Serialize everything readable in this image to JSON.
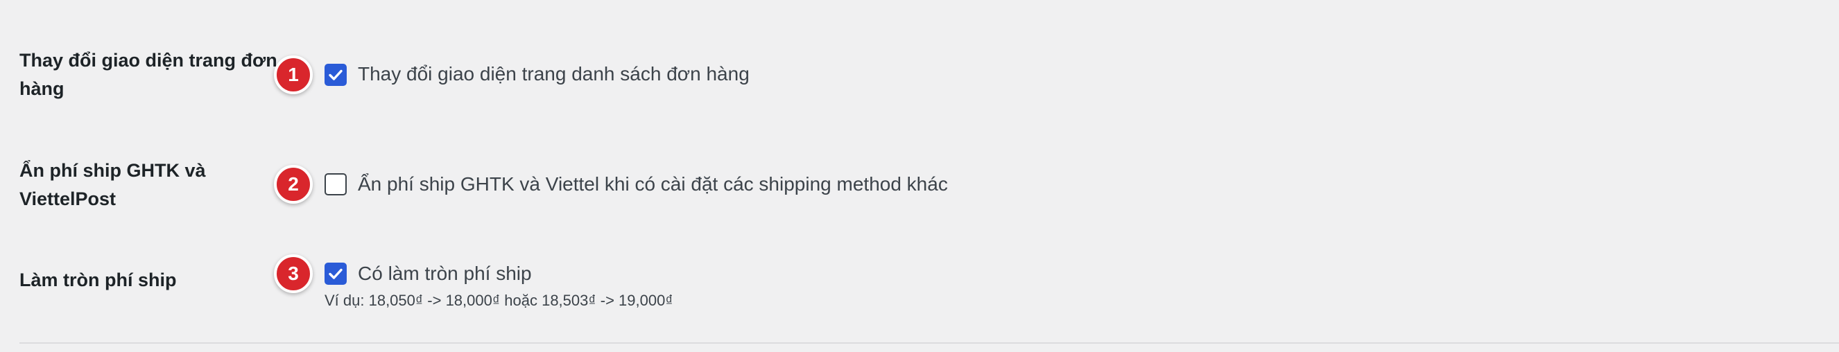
{
  "settings": [
    {
      "number": "1",
      "label": "Thay đổi giao diện trang đơn hàng",
      "checkbox_text": "Thay đổi giao diện trang danh sách đơn hàng",
      "checked": true
    },
    {
      "number": "2",
      "label": "Ẩn phí ship GHTK và ViettelPost",
      "checkbox_text": "Ẩn phí ship GHTK và Viettel khi có cài đặt các shipping method khác",
      "checked": false
    },
    {
      "number": "3",
      "label": "Làm tròn phí ship",
      "checkbox_text": "Có làm tròn phí ship",
      "checked": true,
      "description": "Ví dụ: 18,050₫ -> 18,000₫ hoặc 18,503₫ -> 19,000₫"
    }
  ],
  "colors": {
    "badge": "#d9262c",
    "checkbox_checked": "#2a5bd7",
    "background": "#f0f0f1"
  },
  "icons": {
    "check": "check-icon"
  }
}
